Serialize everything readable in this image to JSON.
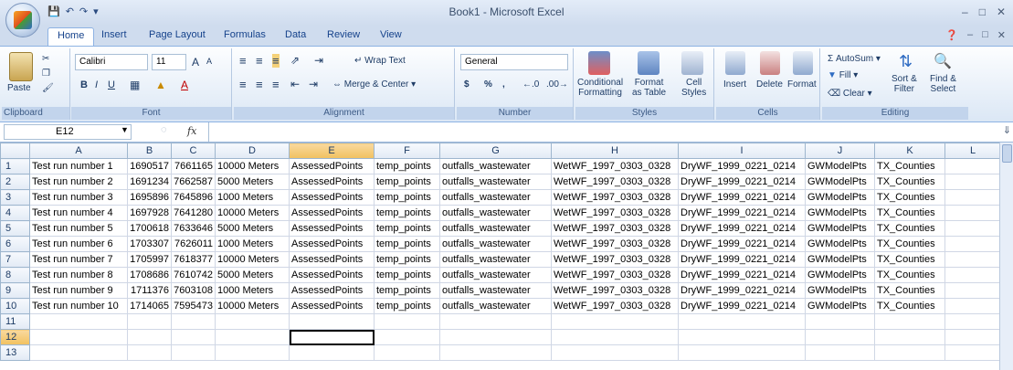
{
  "window": {
    "title": "Book1 - Microsoft Excel"
  },
  "qat": {
    "save_icon": "save-icon",
    "undo_icon": "undo-icon",
    "redo_icon": "redo-icon"
  },
  "tabs": [
    "Home",
    "Insert",
    "Page Layout",
    "Formulas",
    "Data",
    "Review",
    "View"
  ],
  "ribbon": {
    "clipboard": {
      "paste": "Paste",
      "label": "Clipboard"
    },
    "font": {
      "name": "Calibri",
      "size": "11",
      "label": "Font",
      "bold": "B",
      "italic": "I",
      "underline": "U",
      "grow": "A",
      "shrink": "A"
    },
    "alignment": {
      "wrap": "Wrap Text",
      "merge": "Merge & Center",
      "label": "Alignment"
    },
    "number": {
      "format": "General",
      "label": "Number",
      "currency": "$",
      "percent": "%",
      "comma": ","
    },
    "styles": {
      "conditional": "Conditional",
      "conditional2": "Formatting",
      "format_table": "Format",
      "format_table2": "as Table",
      "cell_styles": "Cell",
      "cell_styles2": "Styles",
      "label": "Styles"
    },
    "cells": {
      "insert": "Insert",
      "delete": "Delete",
      "format": "Format",
      "label": "Cells"
    },
    "editing": {
      "autosum": "AutoSum",
      "fill": "Fill",
      "clear": "Clear",
      "sort": "Sort &",
      "sort2": "Filter",
      "find": "Find &",
      "find2": "Select",
      "label": "Editing"
    }
  },
  "formula_bar": {
    "name_box": "E12",
    "fx": "fx",
    "content": ""
  },
  "columns": [
    "A",
    "B",
    "C",
    "D",
    "E",
    "F",
    "G",
    "H",
    "I",
    "J",
    "K",
    "L"
  ],
  "rows": [
    [
      "Test run number 1",
      "1690517",
      "7661165",
      "10000 Meters",
      "AssessedPoints",
      "temp_points",
      "outfalls_wastewater",
      "WetWF_1997_0303_0328",
      "DryWF_1999_0221_0214",
      "GWModelPts",
      "TX_Counties",
      ""
    ],
    [
      "Test run number 2",
      "1691234",
      "7662587",
      "5000 Meters",
      "AssessedPoints",
      "temp_points",
      "outfalls_wastewater",
      "WetWF_1997_0303_0328",
      "DryWF_1999_0221_0214",
      "GWModelPts",
      "TX_Counties",
      ""
    ],
    [
      "Test run number 3",
      "1695896",
      "7645896",
      "1000 Meters",
      "AssessedPoints",
      "temp_points",
      "outfalls_wastewater",
      "WetWF_1997_0303_0328",
      "DryWF_1999_0221_0214",
      "GWModelPts",
      "TX_Counties",
      ""
    ],
    [
      "Test run number 4",
      "1697928",
      "7641280",
      "10000 Meters",
      "AssessedPoints",
      "temp_points",
      "outfalls_wastewater",
      "WetWF_1997_0303_0328",
      "DryWF_1999_0221_0214",
      "GWModelPts",
      "TX_Counties",
      ""
    ],
    [
      "Test run number 5",
      "1700618",
      "7633646",
      "5000 Meters",
      "AssessedPoints",
      "temp_points",
      "outfalls_wastewater",
      "WetWF_1997_0303_0328",
      "DryWF_1999_0221_0214",
      "GWModelPts",
      "TX_Counties",
      ""
    ],
    [
      "Test run number 6",
      "1703307",
      "7626011",
      "1000 Meters",
      "AssessedPoints",
      "temp_points",
      "outfalls_wastewater",
      "WetWF_1997_0303_0328",
      "DryWF_1999_0221_0214",
      "GWModelPts",
      "TX_Counties",
      ""
    ],
    [
      "Test run number 7",
      "1705997",
      "7618377",
      "10000 Meters",
      "AssessedPoints",
      "temp_points",
      "outfalls_wastewater",
      "WetWF_1997_0303_0328",
      "DryWF_1999_0221_0214",
      "GWModelPts",
      "TX_Counties",
      ""
    ],
    [
      "Test run number 8",
      "1708686",
      "7610742",
      "5000 Meters",
      "AssessedPoints",
      "temp_points",
      "outfalls_wastewater",
      "WetWF_1997_0303_0328",
      "DryWF_1999_0221_0214",
      "GWModelPts",
      "TX_Counties",
      ""
    ],
    [
      "Test run number 9",
      "1711376",
      "7603108",
      "1000 Meters",
      "AssessedPoints",
      "temp_points",
      "outfalls_wastewater",
      "WetWF_1997_0303_0328",
      "DryWF_1999_0221_0214",
      "GWModelPts",
      "TX_Counties",
      ""
    ],
    [
      "Test run number 10",
      "1714065",
      "7595473",
      "10000 Meters",
      "AssessedPoints",
      "temp_points",
      "outfalls_wastewater",
      "WetWF_1997_0303_0328",
      "DryWF_1999_0221_0214",
      "GWModelPts",
      "TX_Counties",
      ""
    ],
    [
      "",
      "",
      "",
      "",
      "",
      "",
      "",
      "",
      "",
      "",
      "",
      ""
    ],
    [
      "",
      "",
      "",
      "",
      "",
      "",
      "",
      "",
      "",
      "",
      "",
      ""
    ],
    [
      "",
      "",
      "",
      "",
      "",
      "",
      "",
      "",
      "",
      "",
      "",
      ""
    ]
  ],
  "row_numbers": [
    "1",
    "2",
    "3",
    "4",
    "5",
    "6",
    "7",
    "8",
    "9",
    "10",
    "11",
    "12",
    "13"
  ],
  "active_cell": {
    "row": 12,
    "col": "E"
  },
  "colors": {
    "accent": "#15428b",
    "selected_header": "#f1c15f"
  }
}
